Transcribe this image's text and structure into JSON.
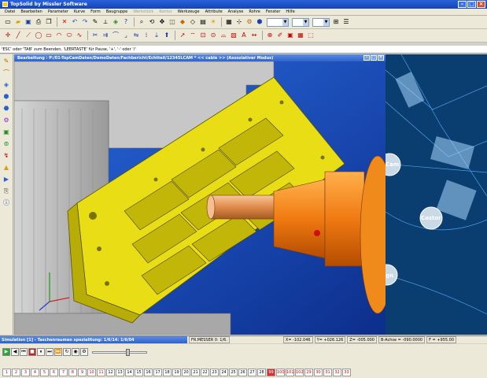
{
  "window": {
    "title": "TopSolid by Missler Software"
  },
  "menu": [
    "Datei",
    "Bearbeiten",
    "Parameter",
    "Kurve",
    "Form",
    "Baugruppe",
    "Werkstück",
    "Kontur",
    "Werkzeuge",
    "Attribute",
    "Analyse",
    "Rohre",
    "Fenster",
    "Hilfe"
  ],
  "menu_disabled": [
    6,
    7
  ],
  "prompt": "'ESC' oder 'TAB' zum Beenden, 'LEERTASTE' für Pause, '+', '-' oder '/'",
  "document": {
    "title": "Bearbeitung : P:/01-TopCamDaten/DemoDaten/Fachbericht/Echtteil/12345LCAM * << cable >> (Assoziativer Modus)"
  },
  "status": {
    "sim_title": "Simulation  [1] - Taschenraumen spezialitung: 1/6/14: 1/6/04",
    "tool_field": "FR.MESSER 0: 1/6.",
    "x": "X= -102.046",
    "y": "Y= +026.126",
    "z": "Z= -005.000",
    "b": "B-Achse = -090.0000",
    "f": "F = +955.00"
  },
  "numrow": {
    "items": [
      "1",
      "2",
      "3",
      "4",
      "5",
      "6",
      "7",
      "8",
      "9",
      "10",
      "11",
      "12",
      "13",
      "14",
      "15",
      "16",
      "17",
      "18",
      "19",
      "20",
      "21",
      "22",
      "23",
      "24",
      "25",
      "26",
      "27",
      "28",
      "99",
      "100",
      "101",
      "102",
      "29",
      "30",
      "31",
      "32",
      "33"
    ],
    "highlight_index": 28
  },
  "viewport_labels": {
    "cam": "Cam",
    "castor": "Castor",
    "gn": "gn"
  },
  "colors": {
    "part": "#f0e81e",
    "tool": "#f08a1a",
    "background": "#1c4fbe",
    "accent": "#2a62d8"
  }
}
